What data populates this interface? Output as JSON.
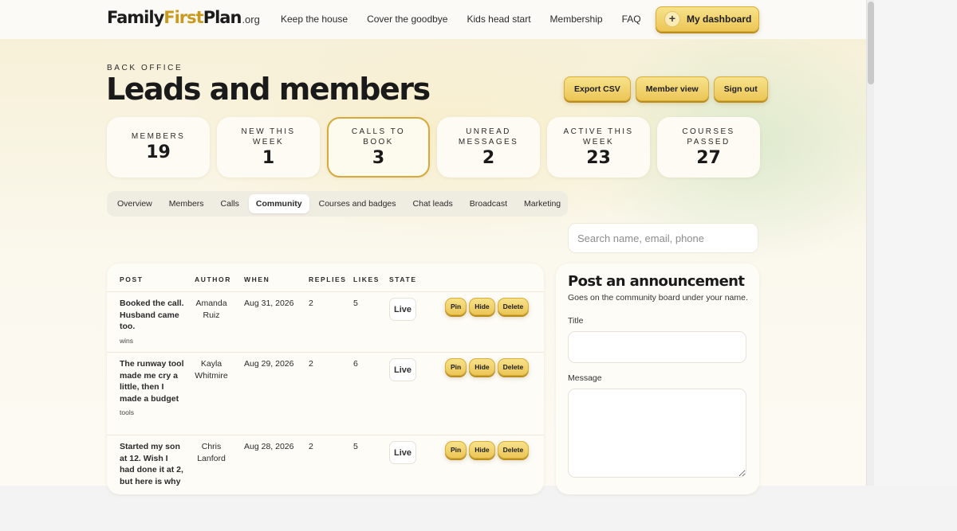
{
  "header": {
    "logo": {
      "part1": "Family",
      "part2": "First",
      "part3": "Plan",
      "tld": ".org"
    },
    "nav": [
      "Keep the house",
      "Cover the goodbye",
      "Kids head start",
      "Membership",
      "FAQ"
    ],
    "dashboard_label": "My dashboard",
    "dashboard_icon": "plus-icon"
  },
  "page": {
    "eyebrow": "BACK OFFICE",
    "title": "Leads and members",
    "actions": [
      "Export CSV",
      "Member view",
      "Sign out"
    ]
  },
  "stats": [
    {
      "label": "MEMBERS",
      "value": "19"
    },
    {
      "label": "NEW THIS WEEK",
      "value": "1"
    },
    {
      "label": "CALLS TO BOOK",
      "value": "3",
      "selected": true
    },
    {
      "label": "UNREAD MESSAGES",
      "value": "2"
    },
    {
      "label": "ACTIVE THIS WEEK",
      "value": "23"
    },
    {
      "label": "COURSES PASSED",
      "value": "27"
    }
  ],
  "tabs": [
    "Overview",
    "Members",
    "Calls",
    "Community",
    "Courses and badges",
    "Chat leads",
    "Broadcast",
    "Marketing"
  ],
  "active_tab": "Community",
  "search": {
    "placeholder": "Search name, email, phone"
  },
  "table": {
    "columns": [
      "POST",
      "AUTHOR",
      "WHEN",
      "REPLIES",
      "LIKES",
      "STATE"
    ],
    "action_labels": {
      "pin": "Pin",
      "hide": "Hide",
      "delete": "Delete"
    },
    "rows": [
      {
        "post": "Booked the call. Husband came too.",
        "tag": "wins",
        "author": "Amanda Ruiz",
        "when": "Aug 31, 2026",
        "replies": "2",
        "likes": "5",
        "state": "Live"
      },
      {
        "post": "The runway tool made me cry a little, then I made a budget",
        "tag": "tools",
        "author": "Kayla Whitmire",
        "when": "Aug 29, 2026",
        "replies": "2",
        "likes": "6",
        "state": "Live"
      },
      {
        "post": "Started my son at 12. Wish I had done it at 2, but here is why",
        "tag": "",
        "author": "Chris Lanford",
        "when": "Aug 28, 2026",
        "replies": "2",
        "likes": "5",
        "state": "Live"
      }
    ]
  },
  "announcement": {
    "title": "Post an announcement",
    "subtitle": "Goes on the community board under your name.",
    "title_label": "Title",
    "title_value": "",
    "message_label": "Message",
    "message_value": ""
  },
  "colors": {
    "accent_gold": "#ecc657",
    "logo_accent": "#c89a1e",
    "background": "#f8f3df"
  }
}
